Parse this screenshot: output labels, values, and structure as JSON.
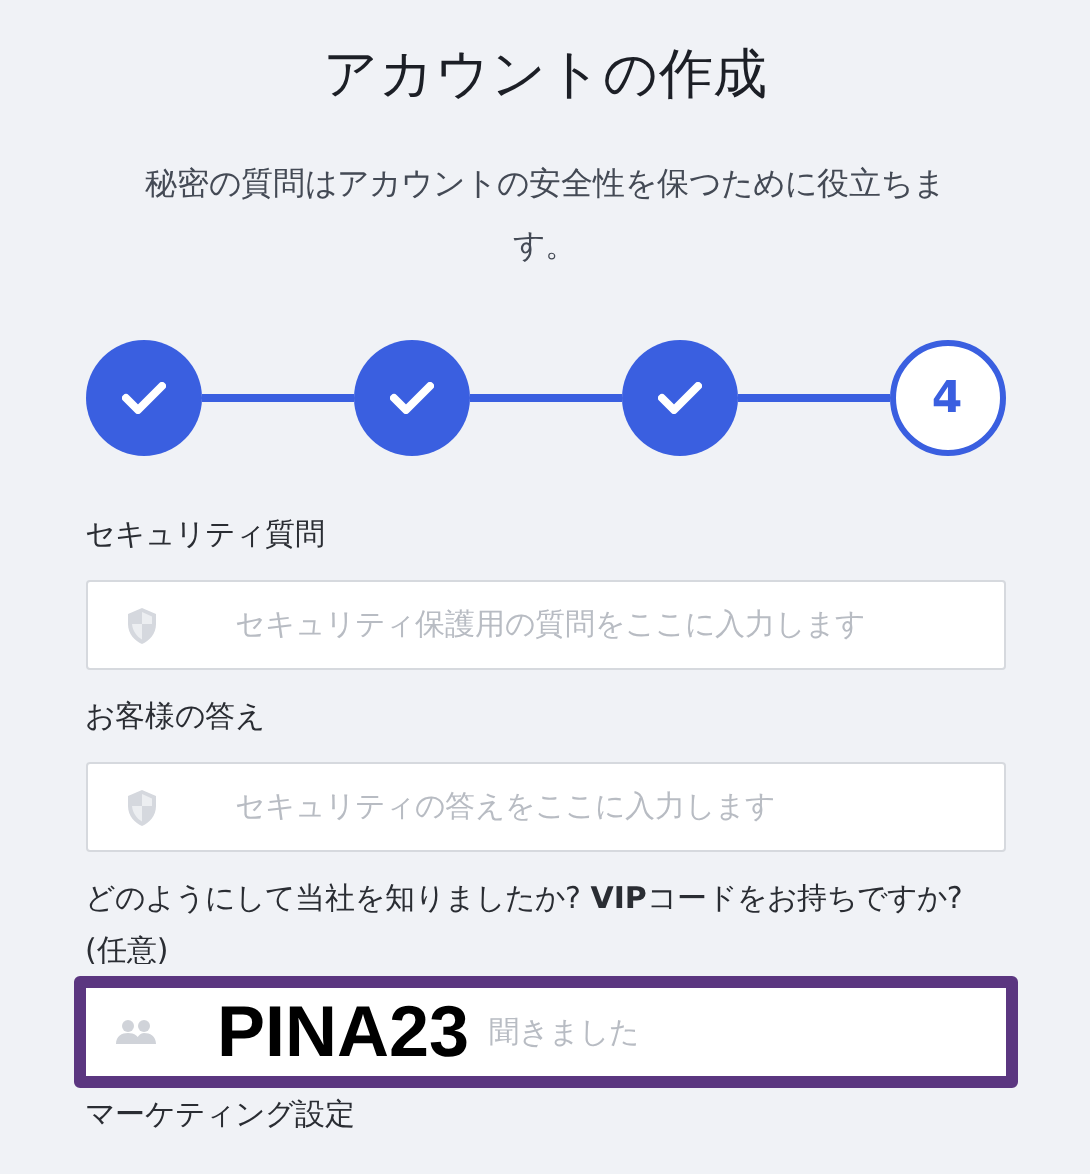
{
  "title": "アカウントの作成",
  "subtitle": "秘密の質問はアカウントの安全性を保つために役立ちます。",
  "steps": [
    {
      "completed": true
    },
    {
      "completed": true
    },
    {
      "completed": true
    },
    {
      "completed": false,
      "label": "4"
    }
  ],
  "fields": [
    {
      "label": "セキュリティ質問",
      "kind": "secret",
      "placeholder": "セキュリティ保護用の質問をここに入力します",
      "focused": false
    },
    {
      "label": "お客様の答え",
      "kind": "secret",
      "placeholder": "セキュリティの答えをここに入力します",
      "focused": false
    },
    {
      "label": "どのようにして当社を知りましたか? **VIP**コードをお持ちですか? (任意)",
      "kind": "referral",
      "overlay_text": "PINA23",
      "placeholder": "聞きました",
      "focused": true
    }
  ],
  "section_label": "マーケティング設定"
}
